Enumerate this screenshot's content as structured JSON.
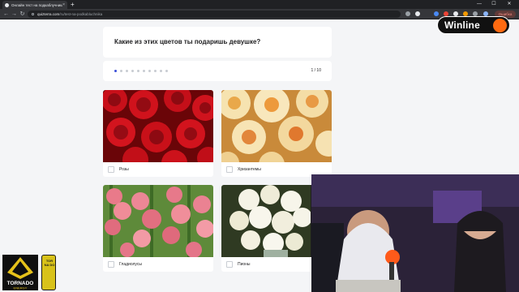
{
  "browser": {
    "tab_title": "Онлайн тест на подкаблучника",
    "new_tab": "+",
    "url_domain": "quizterra.com",
    "url_path": "/ru/test-na-podkabluchnika",
    "error_button": "Ошибка",
    "controls": {
      "minimize": "—",
      "maximize": "☐",
      "close": "✕"
    },
    "tab_close": "×"
  },
  "quiz": {
    "question": "Какие из этих цветов ты подаришь девушке?",
    "progress_label": "1 / 10",
    "progress_current": 1,
    "progress_total": 10,
    "options": [
      {
        "label": "Розы",
        "image": "red-roses"
      },
      {
        "label": "Хризантемы",
        "image": "chrysanthemums"
      },
      {
        "label": "Гладиолусы",
        "image": "gladioli"
      },
      {
        "label": "Пионы",
        "image": "peonies"
      }
    ]
  },
  "overlays": {
    "sponsor": "Winline",
    "energy_brand": "TORNADO",
    "energy_sub": "ENERGY",
    "can_text": "TOR NA DO"
  },
  "colors": {
    "accent": "#3b4fd8",
    "winline_orange": "#ff6a10"
  }
}
